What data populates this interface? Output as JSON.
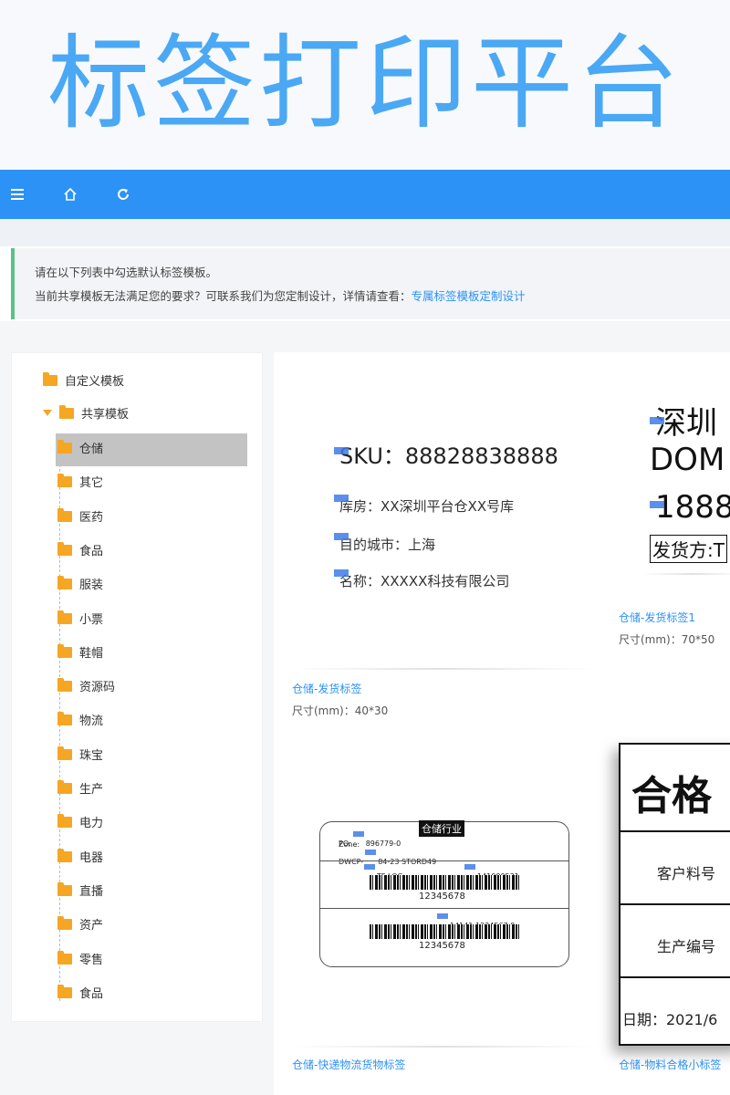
{
  "banner": {
    "title": "标签打印平台"
  },
  "toolbar": {
    "icons": [
      "menu-icon",
      "home-icon",
      "refresh-icon"
    ]
  },
  "notice": {
    "line1": "请在以下列表中勾选默认标签模板。",
    "line2": "当前共享模板无法满足您的要求？可联系我们为您定制设计，详情请查看：",
    "link": "专属标签模板定制设计"
  },
  "tree": {
    "root_custom": "自定义模板",
    "root_shared": "共享模板",
    "children": [
      "仓储",
      "其它",
      "医药",
      "食品",
      "服装",
      "小票",
      "鞋帽",
      "资源码",
      "物流",
      "珠宝",
      "生产",
      "电力",
      "电器",
      "直播",
      "资产",
      "零售",
      "食品"
    ]
  },
  "templates": {
    "card_a": {
      "sku": "SKU：88828838888",
      "warehouse": "库房：XX深圳平台仓XX号库",
      "city": "目的城市：上海",
      "name": "名称：XXXXX科技有限公司",
      "caption": "仓储-发货标签",
      "size": "尺寸(mm)：40*30"
    },
    "card_b": {
      "line1": "深圳",
      "line2": "DOM",
      "line3": "1888",
      "line4": "发货方:T",
      "caption": "仓储-发货标签1",
      "size": "尺寸(mm)：70*50"
    },
    "card_c": {
      "header": "仓储行业",
      "po": "PO:",
      "po_val": "896779-0",
      "zone": "Zone:",
      "dwcp": "DWCP-",
      "dwcp_val": "84-23 STORD49",
      "tf": "TF LOC",
      "tf_val": "141000531",
      "num1": "12345678",
      "mid": "14141 1234567 0",
      "num2": "12345678",
      "caption": "仓储-快递物流货物标签"
    },
    "card_d": {
      "title": "合格",
      "row1": "客户料号",
      "row2": "生产编号",
      "date": "日期：2021/6",
      "caption": "仓储-物料合格小标签"
    }
  }
}
